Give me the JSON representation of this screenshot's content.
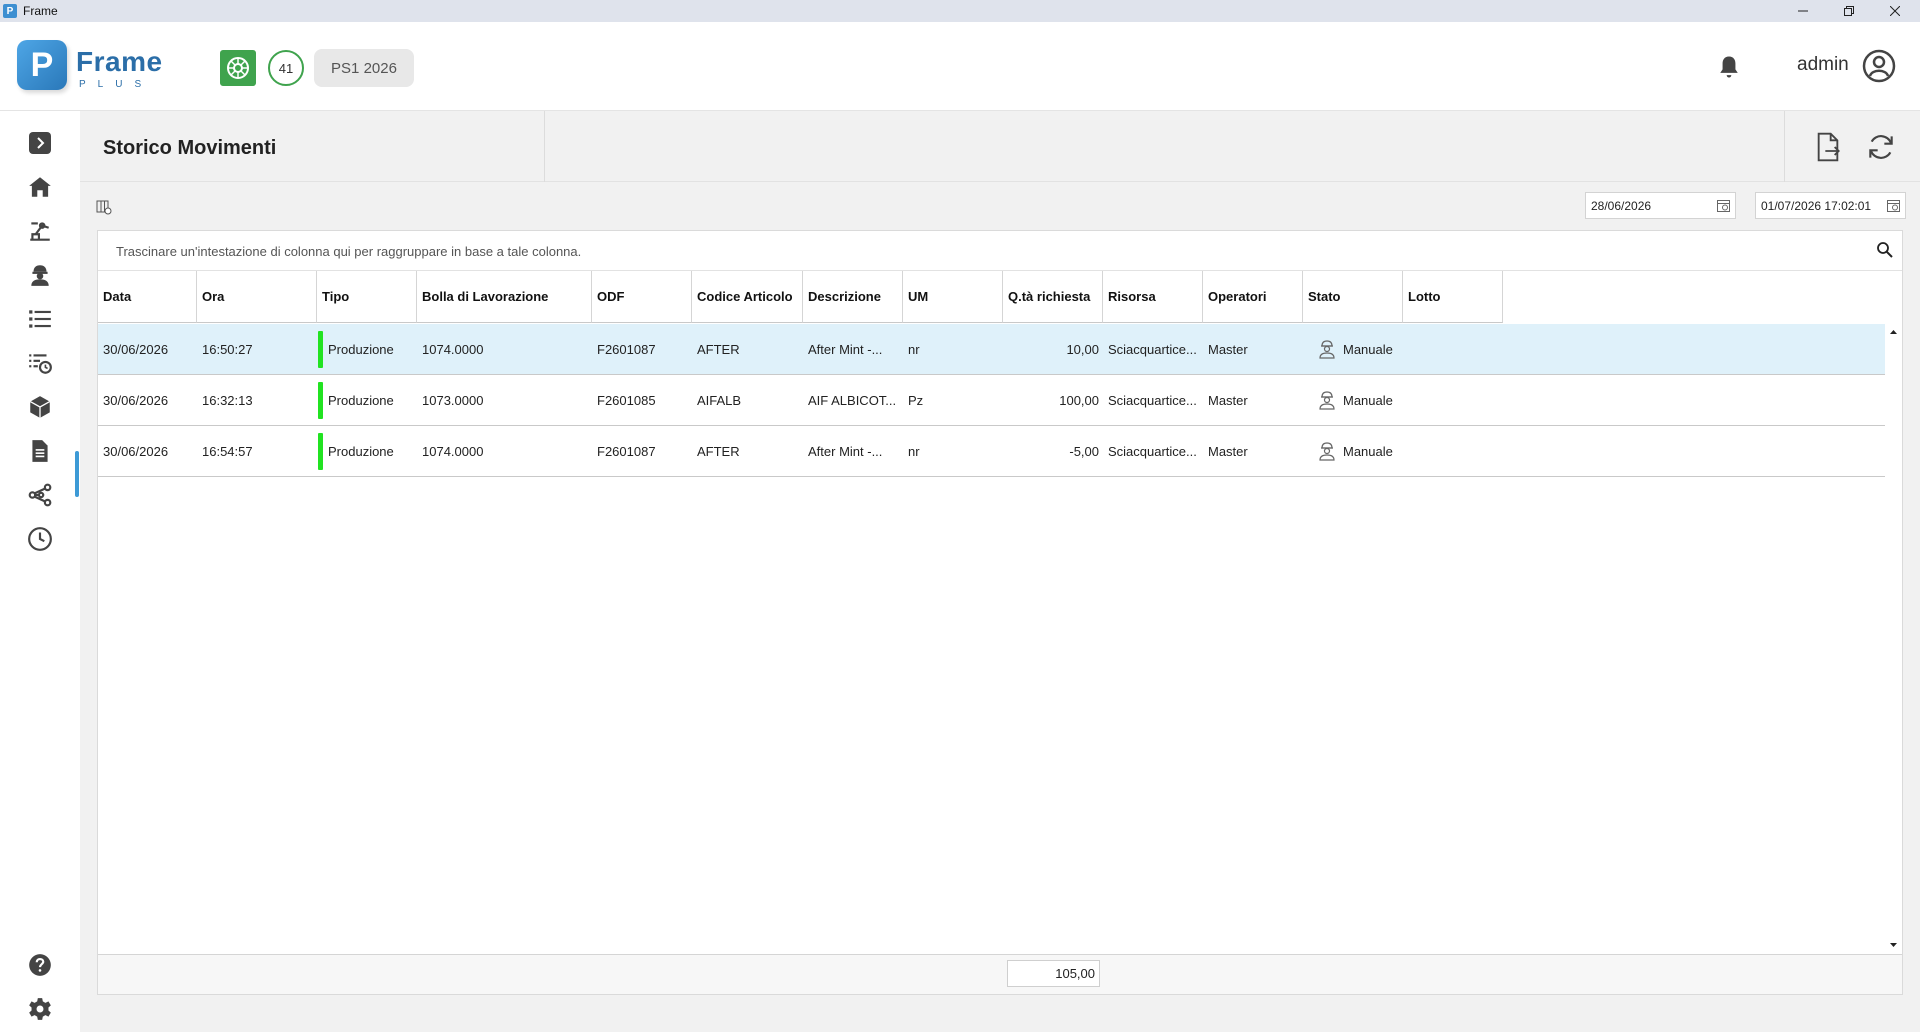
{
  "window": {
    "title": "Frame",
    "app_icon": "P",
    "controls": [
      "minimize-icon",
      "restore-icon",
      "close-icon"
    ]
  },
  "header": {
    "logo_letter": "P",
    "logo_name": "Frame",
    "logo_sub": "PLUS",
    "badge_count": "41",
    "period": "PS1 2026",
    "user": "admin",
    "accent_color": "#2b6ea8",
    "green_color": "#3fa34d"
  },
  "sidebar": {
    "items": [
      {
        "icon": "expand-icon"
      },
      {
        "icon": "home-icon"
      },
      {
        "icon": "machine-icon"
      },
      {
        "icon": "operator-icon"
      },
      {
        "icon": "list-icon"
      },
      {
        "icon": "history-icon",
        "active": true
      },
      {
        "icon": "box-icon"
      },
      {
        "icon": "document-icon"
      },
      {
        "icon": "share-icon"
      },
      {
        "icon": "clock-icon"
      },
      {
        "icon": "help-icon"
      },
      {
        "icon": "settings-icon"
      }
    ]
  },
  "page": {
    "title": "Storico Movimenti",
    "date_from": "28/06/2026",
    "date_to": "01/07/2026 17:02:01",
    "group_hint": "Trascinare un'intestazione di colonna qui per raggruppare in base a tale colonna."
  },
  "grid": {
    "columns": [
      "Data",
      "Ora",
      "Tipo",
      "Bolla di Lavorazione",
      "ODF",
      "Codice Articolo",
      "Descrizione",
      "UM",
      "Q.tà richiesta",
      "Risorsa",
      "Operatori",
      "Stato",
      "Lotto"
    ],
    "rows": [
      {
        "data": "30/06/2026",
        "ora": "16:50:27",
        "tipo": "Produzione",
        "bolla": "1074.0000",
        "odf": "F2601087",
        "codice": "AFTER",
        "descrizione": "After Mint -...",
        "um": "nr",
        "qta": "10,00",
        "risorsa": "Sciacquartice...",
        "operatori": "Master",
        "stato": "Manuale",
        "lotto": "",
        "selected": true
      },
      {
        "data": "30/06/2026",
        "ora": "16:32:13",
        "tipo": "Produzione",
        "bolla": "1073.0000",
        "odf": "F2601085",
        "codice": "AIFALB",
        "descrizione": "AIF ALBICOT...",
        "um": "Pz",
        "qta": "100,00",
        "risorsa": "Sciacquartice...",
        "operatori": "Master",
        "stato": "Manuale",
        "lotto": ""
      },
      {
        "data": "30/06/2026",
        "ora": "16:54:57",
        "tipo": "Produzione",
        "bolla": "1074.0000",
        "odf": "F2601087",
        "codice": "AFTER",
        "descrizione": "After Mint -...",
        "um": "nr",
        "qta": "-5,00",
        "risorsa": "Sciacquartice...",
        "operatori": "Master",
        "stato": "Manuale",
        "lotto": ""
      }
    ],
    "total_qta": "105,00",
    "tipo_color": "#21e321",
    "selected_row_color": "#dff1fa"
  }
}
